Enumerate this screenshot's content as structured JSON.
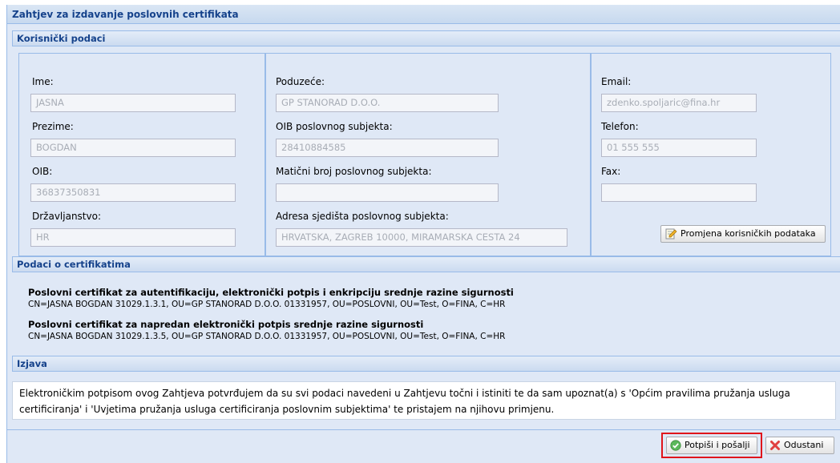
{
  "window": {
    "title": "Zahtjev za izdavanje poslovnih certifikata"
  },
  "user_section": {
    "title": "Korisnički podaci",
    "ime": {
      "label": "Ime:",
      "value": "JASNA"
    },
    "prezime": {
      "label": "Prezime:",
      "value": "BOGDAN"
    },
    "oib": {
      "label": "OIB:",
      "value": "36837350831"
    },
    "drzavljanstvo": {
      "label": "Državljanstvo:",
      "value": "HR"
    },
    "poduzece": {
      "label": "Poduzeće:",
      "value": "GP STANORAD D.O.O."
    },
    "oib_subjekta": {
      "label": "OIB poslovnog subjekta:",
      "value": "28410884585"
    },
    "maticni_broj": {
      "label": "Matični broj poslovnog subjekta:",
      "value": ""
    },
    "adresa": {
      "label": "Adresa sjedišta poslovnog subjekta:",
      "value": "HRVATSKA, ZAGREB 10000, MIRAMARSKA CESTA 24"
    },
    "email": {
      "label": "Email:",
      "value": "zdenko.spoljaric@fina.hr"
    },
    "telefon": {
      "label": "Telefon:",
      "value": "01 555 555"
    },
    "fax": {
      "label": "Fax:",
      "value": ""
    },
    "change_button": "Promjena korisničkih podataka"
  },
  "cert_section": {
    "title": "Podaci o certifikatima",
    "certs": [
      {
        "title": "Poslovni certifikat za autentifikaciju, elektronički potpis i enkripciju srednje razine sigurnosti",
        "dn": "CN=JASNA BOGDAN 31029.1.3.1, OU=GP STANORAD D.O.O. 01331957, OU=POSLOVNI, OU=Test, O=FINA, C=HR"
      },
      {
        "title": "Poslovni certifikat za napredan elektronički potpis srednje razine sigurnosti",
        "dn": "CN=JASNA BOGDAN 31029.1.3.5, OU=GP STANORAD D.O.O. 01331957, OU=POSLOVNI, OU=Test, O=FINA, C=HR"
      }
    ]
  },
  "statement_section": {
    "title": "Izjava",
    "text": "Elektroničkim potpisom ovog Zahtjeva potvrđujem da su svi podaci navedeni u Zahtjevu točni i istiniti te da sam upoznat(a) s 'Općim pravilima pružanja usluga certificiranja' i 'Uvjetima pružanja usluga certificiranja poslovnim subjektima' te pristajem na njihovu primjenu."
  },
  "footer": {
    "sign_button": "Potpiši i pošalji",
    "cancel_button": "Odustani"
  },
  "colors": {
    "panel_bg": "#dfe8f6",
    "header_text": "#15428b",
    "border": "#99bbe8",
    "highlight_border": "#e0151b"
  }
}
